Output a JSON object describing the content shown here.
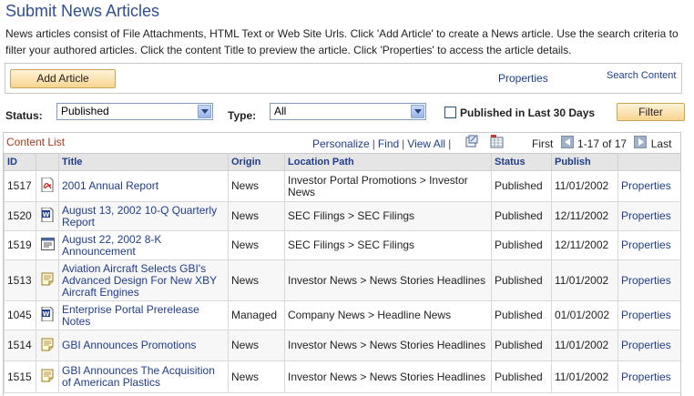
{
  "header": {
    "title": "Submit News Articles",
    "intro": "News articles consist of File Attachments, HTML Text or Web Site Urls.  Click 'Add Article' to create a News article.  Use the search criteria to filter your authored articles. Click the content Title to preview the article.  Click 'Properties' to access the article details."
  },
  "actions": {
    "add_article": "Add Article",
    "properties": "Properties",
    "search_content": "Search Content"
  },
  "filters": {
    "status_label": "Status:",
    "status_value": "Published",
    "type_label": "Type:",
    "type_value": "All",
    "last30_label": "Published in Last 30 Days",
    "last30_checked": false,
    "filter_button": "Filter"
  },
  "grid": {
    "title": "Content List",
    "personalize": "Personalize",
    "find": "Find",
    "view_all": "View All",
    "pager_first": "First",
    "pager_range": "1-17 of 17",
    "pager_last": "Last",
    "columns": [
      "ID",
      "Title",
      "Origin",
      "Location Path",
      "Status",
      "Publish"
    ],
    "rows": [
      {
        "id": "1517",
        "icon": "pdf-icon",
        "title": "2001 Annual Report",
        "origin": "News",
        "location": "Investor Portal Promotions > Investor News",
        "status": "Published",
        "publish": "11/01/2002",
        "action": "Properties"
      },
      {
        "id": "1520",
        "icon": "word-doc-icon",
        "title": "August 13, 2002 10-Q Quarterly Report",
        "origin": "News",
        "location": "SEC Filings > SEC Filings",
        "status": "Published",
        "publish": "12/11/2002",
        "action": "Properties"
      },
      {
        "id": "1519",
        "icon": "text-doc-icon",
        "title": "August 22, 2002 8-K Announcement",
        "origin": "News",
        "location": "SEC Filings > SEC Filings",
        "status": "Published",
        "publish": "12/11/2002",
        "action": "Properties"
      },
      {
        "id": "1513",
        "icon": "note-icon",
        "title": "Aviation Aircraft Selects GBI's Advanced Design For New XBY Aircraft Engines",
        "origin": "News",
        "location": "Investor News > News Stories Headlines",
        "status": "Published",
        "publish": "11/01/2002",
        "action": "Properties"
      },
      {
        "id": "1045",
        "icon": "word-doc-icon",
        "title": "Enterprise Portal Prerelease Notes",
        "origin": "Managed",
        "location": "Company News > Headline News",
        "status": "Published",
        "publish": "01/01/2002",
        "action": "Properties"
      },
      {
        "id": "1514",
        "icon": "note-icon",
        "title": "GBI Announces Promotions",
        "origin": "News",
        "location": "Investor News > News Stories Headlines",
        "status": "Published",
        "publish": "11/01/2002",
        "action": "Properties"
      },
      {
        "id": "1515",
        "icon": "note-icon",
        "title": "GBI Announces The Acquisition of American Plastics",
        "origin": "News",
        "location": "Investor News > News Stories Headlines",
        "status": "Published",
        "publish": "11/01/2002",
        "action": "Properties"
      }
    ]
  }
}
